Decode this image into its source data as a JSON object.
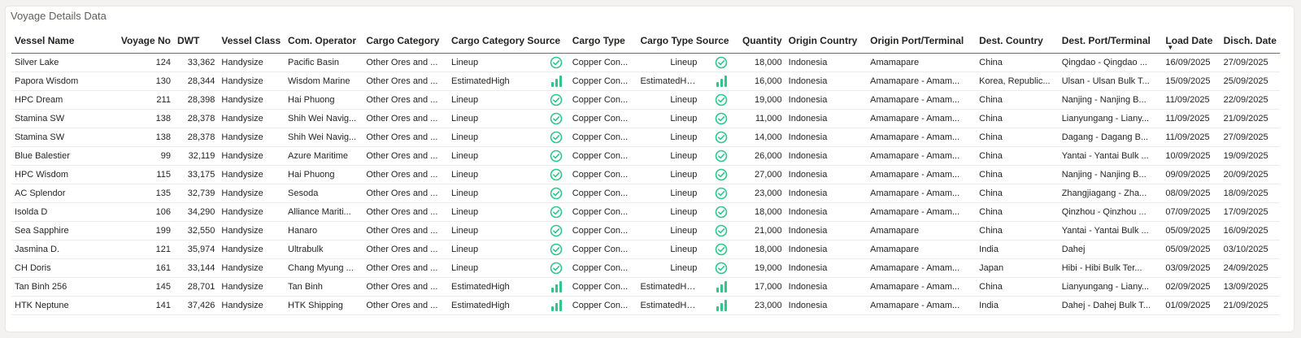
{
  "title": "Voyage Details Data",
  "colors": {
    "accent": "#2b7bd1",
    "icon": "#2fc68b"
  },
  "columns": [
    "Vessel Name",
    "Voyage No",
    "DWT",
    "Vessel Class",
    "Com. Operator",
    "Cargo Category",
    "Cargo Category Source",
    "Cargo Type",
    "Cargo Type Source",
    "Quantity",
    "Origin Country",
    "Origin Port/Terminal",
    "Dest. Country",
    "Dest. Port/Terminal",
    "Load Date",
    "Disch. Date"
  ],
  "sorted_column": "Load Date",
  "sort_direction": "descending",
  "rows": [
    {
      "vessel": "Silver Lake",
      "voyage": "124",
      "dwt": "33,362",
      "class": "Handysize",
      "operator": "Pacific Basin",
      "cat": "Other Ores and ...",
      "cat_src": "Lineup",
      "cat_icon": "check-circle-icon",
      "type": "Copper Con...",
      "type_src": "Lineup",
      "type_icon": "check-circle-icon",
      "qty": "18,000",
      "o_country": "Indonesia",
      "o_port": "Amamapare",
      "d_country": "China",
      "d_port": "Qingdao - Qingdao ...",
      "load": "16/09/2025",
      "disch": "27/09/2025"
    },
    {
      "vessel": "Papora Wisdom",
      "voyage": "130",
      "dwt": "28,344",
      "class": "Handysize",
      "operator": "Wisdom Marine",
      "cat": "Other Ores and ...",
      "cat_src": "EstimatedHigh",
      "cat_icon": "signal-bars-icon",
      "type": "Copper Con...",
      "type_src": "EstimatedHigh",
      "type_icon": "signal-bars-icon",
      "qty": "16,000",
      "o_country": "Indonesia",
      "o_port": "Amamapare - Amam...",
      "d_country": "Korea, Republic...",
      "d_port": "Ulsan - Ulsan Bulk T...",
      "load": "15/09/2025",
      "disch": "25/09/2025"
    },
    {
      "vessel": "HPC Dream",
      "voyage": "211",
      "dwt": "28,398",
      "class": "Handysize",
      "operator": "Hai Phuong",
      "cat": "Other Ores and ...",
      "cat_src": "Lineup",
      "cat_icon": "check-circle-icon",
      "type": "Copper Con...",
      "type_src": "Lineup",
      "type_icon": "check-circle-icon",
      "qty": "19,000",
      "o_country": "Indonesia",
      "o_port": "Amamapare - Amam...",
      "d_country": "China",
      "d_port": "Nanjing - Nanjing B...",
      "load": "11/09/2025",
      "disch": "22/09/2025"
    },
    {
      "vessel": "Stamina SW",
      "voyage": "138",
      "dwt": "28,378",
      "class": "Handysize",
      "operator": "Shih Wei Navig...",
      "cat": "Other Ores and ...",
      "cat_src": "Lineup",
      "cat_icon": "check-circle-icon",
      "type": "Copper Con...",
      "type_src": "Lineup",
      "type_icon": "check-circle-icon",
      "qty": "11,000",
      "o_country": "Indonesia",
      "o_port": "Amamapare - Amam...",
      "d_country": "China",
      "d_port": "Lianyungang - Liany...",
      "load": "11/09/2025",
      "disch": "21/09/2025"
    },
    {
      "vessel": "Stamina SW",
      "voyage": "138",
      "dwt": "28,378",
      "class": "Handysize",
      "operator": "Shih Wei Navig...",
      "cat": "Other Ores and ...",
      "cat_src": "Lineup",
      "cat_icon": "check-circle-icon",
      "type": "Copper Con...",
      "type_src": "Lineup",
      "type_icon": "check-circle-icon",
      "qty": "14,000",
      "o_country": "Indonesia",
      "o_port": "Amamapare - Amam...",
      "d_country": "China",
      "d_port": "Dagang - Dagang B...",
      "load": "11/09/2025",
      "disch": "27/09/2025"
    },
    {
      "vessel": "Blue Balestier",
      "voyage": "99",
      "dwt": "32,119",
      "class": "Handysize",
      "operator": "Azure Maritime",
      "cat": "Other Ores and ...",
      "cat_src": "Lineup",
      "cat_icon": "check-circle-icon",
      "type": "Copper Con...",
      "type_src": "Lineup",
      "type_icon": "check-circle-icon",
      "qty": "26,000",
      "o_country": "Indonesia",
      "o_port": "Amamapare - Amam...",
      "d_country": "China",
      "d_port": "Yantai - Yantai Bulk ...",
      "load": "10/09/2025",
      "disch": "19/09/2025"
    },
    {
      "vessel": "HPC Wisdom",
      "voyage": "115",
      "dwt": "33,175",
      "class": "Handysize",
      "operator": "Hai Phuong",
      "cat": "Other Ores and ...",
      "cat_src": "Lineup",
      "cat_icon": "check-circle-icon",
      "type": "Copper Con...",
      "type_src": "Lineup",
      "type_icon": "check-circle-icon",
      "qty": "27,000",
      "o_country": "Indonesia",
      "o_port": "Amamapare - Amam...",
      "d_country": "China",
      "d_port": "Nanjing - Nanjing B...",
      "load": "09/09/2025",
      "disch": "20/09/2025"
    },
    {
      "vessel": "AC Splendor",
      "voyage": "135",
      "dwt": "32,739",
      "class": "Handysize",
      "operator": "Sesoda",
      "cat": "Other Ores and ...",
      "cat_src": "Lineup",
      "cat_icon": "check-circle-icon",
      "type": "Copper Con...",
      "type_src": "Lineup",
      "type_icon": "check-circle-icon",
      "qty": "23,000",
      "o_country": "Indonesia",
      "o_port": "Amamapare - Amam...",
      "d_country": "China",
      "d_port": "Zhangjiagang - Zha...",
      "load": "08/09/2025",
      "disch": "18/09/2025"
    },
    {
      "vessel": "Isolda D",
      "voyage": "106",
      "dwt": "34,290",
      "class": "Handysize",
      "operator": "Alliance Mariti...",
      "cat": "Other Ores and ...",
      "cat_src": "Lineup",
      "cat_icon": "check-circle-icon",
      "type": "Copper Con...",
      "type_src": "Lineup",
      "type_icon": "check-circle-icon",
      "qty": "18,000",
      "o_country": "Indonesia",
      "o_port": "Amamapare - Amam...",
      "d_country": "China",
      "d_port": "Qinzhou - Qinzhou ...",
      "load": "07/09/2025",
      "disch": "17/09/2025"
    },
    {
      "vessel": "Sea Sapphire",
      "voyage": "199",
      "dwt": "32,550",
      "class": "Handysize",
      "operator": "Hanaro",
      "cat": "Other Ores and ...",
      "cat_src": "Lineup",
      "cat_icon": "check-circle-icon",
      "type": "Copper Con...",
      "type_src": "Lineup",
      "type_icon": "check-circle-icon",
      "qty": "21,000",
      "o_country": "Indonesia",
      "o_port": "Amamapare",
      "d_country": "China",
      "d_port": "Yantai - Yantai Bulk ...",
      "load": "05/09/2025",
      "disch": "16/09/2025"
    },
    {
      "vessel": "Jasmina D.",
      "voyage": "121",
      "dwt": "35,974",
      "class": "Handysize",
      "operator": "Ultrabulk",
      "cat": "Other Ores and ...",
      "cat_src": "Lineup",
      "cat_icon": "check-circle-icon",
      "type": "Copper Con...",
      "type_src": "Lineup",
      "type_icon": "check-circle-icon",
      "qty": "18,000",
      "o_country": "Indonesia",
      "o_port": "Amamapare",
      "d_country": "India",
      "d_port": "Dahej",
      "load": "05/09/2025",
      "disch": "03/10/2025"
    },
    {
      "vessel": "CH Doris",
      "voyage": "161",
      "dwt": "33,144",
      "class": "Handysize",
      "operator": "Chang Myung ...",
      "cat": "Other Ores and ...",
      "cat_src": "Lineup",
      "cat_icon": "check-circle-icon",
      "type": "Copper Con...",
      "type_src": "Lineup",
      "type_icon": "check-circle-icon",
      "qty": "19,000",
      "o_country": "Indonesia",
      "o_port": "Amamapare - Amam...",
      "d_country": "Japan",
      "d_port": "Hibi - Hibi Bulk Ter...",
      "load": "03/09/2025",
      "disch": "24/09/2025"
    },
    {
      "vessel": "Tan Binh 256",
      "voyage": "145",
      "dwt": "28,701",
      "class": "Handysize",
      "operator": "Tan Binh",
      "cat": "Other Ores and ...",
      "cat_src": "EstimatedHigh",
      "cat_icon": "signal-bars-icon",
      "type": "Copper Con...",
      "type_src": "EstimatedHigh",
      "type_icon": "signal-bars-icon",
      "qty": "17,000",
      "o_country": "Indonesia",
      "o_port": "Amamapare - Amam...",
      "d_country": "China",
      "d_port": "Lianyungang - Liany...",
      "load": "02/09/2025",
      "disch": "13/09/2025"
    },
    {
      "vessel": "HTK Neptune",
      "voyage": "141",
      "dwt": "37,426",
      "class": "Handysize",
      "operator": "HTK Shipping",
      "cat": "Other Ores and ...",
      "cat_src": "EstimatedHigh",
      "cat_icon": "signal-bars-icon",
      "type": "Copper Con...",
      "type_src": "EstimatedHigh",
      "type_icon": "signal-bars-icon",
      "qty": "23,000",
      "o_country": "Indonesia",
      "o_port": "Amamapare - Amam...",
      "d_country": "India",
      "d_port": "Dahej - Dahej Bulk T...",
      "load": "01/09/2025",
      "disch": "21/09/2025"
    }
  ]
}
